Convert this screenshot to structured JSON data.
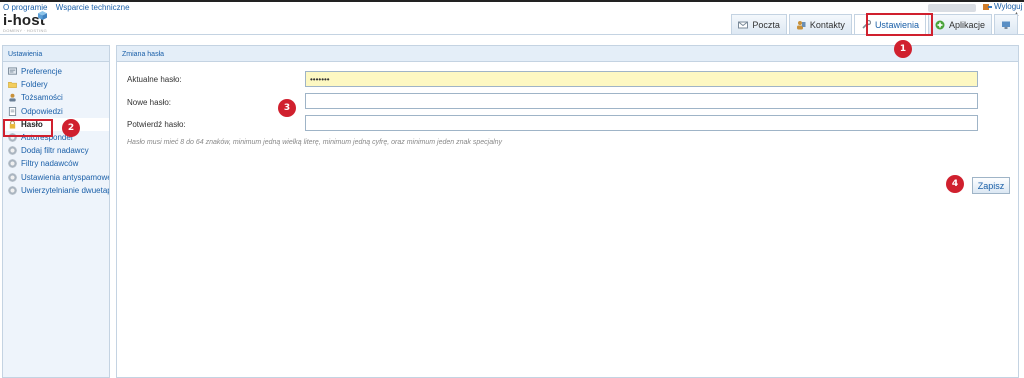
{
  "top_links": [
    "O programie",
    "Wsparcie techniczne"
  ],
  "logo_text": "i-host",
  "logo_sub": "DOMENY · HOSTING",
  "logout_label": "Wyloguj",
  "tabs": [
    {
      "label": "Poczta",
      "icon": "mail-icon"
    },
    {
      "label": "Kontakty",
      "icon": "contacts-icon"
    },
    {
      "label": "Ustawienia",
      "icon": "wrench-icon"
    },
    {
      "label": "Aplikacje",
      "icon": "plus-circle-icon"
    }
  ],
  "sidebar": {
    "title": "Ustawienia",
    "items": [
      {
        "label": "Preferencje",
        "icon": "preferences-icon"
      },
      {
        "label": "Foldery",
        "icon": "folder-icon"
      },
      {
        "label": "Tożsamości",
        "icon": "person-icon"
      },
      {
        "label": "Odpowiedzi",
        "icon": "document-icon"
      },
      {
        "label": "Hasło",
        "icon": "lock-icon"
      },
      {
        "label": "Autoresponder",
        "icon": "gear-icon"
      },
      {
        "label": "Dodaj filtr nadawcy",
        "icon": "gear-icon"
      },
      {
        "label": "Filtry nadawców",
        "icon": "gear-icon"
      },
      {
        "label": "Ustawienia antyspamowe",
        "icon": "gear-icon"
      },
      {
        "label": "Uwierzytelnianie dwuetapowe",
        "icon": "gear-icon"
      }
    ]
  },
  "panel": {
    "title": "Zmiana hasła",
    "current_label": "Aktualne hasło:",
    "current_value": "•••••••",
    "new_label": "Nowe hasło:",
    "confirm_label": "Potwierdź hasło:",
    "hint": "Hasło musi mieć 8 do 64 znaków, minimum jedną wielką literę, minimum jedną cyfrę, oraz minimum jeden znak specjalny",
    "save_label": "Zapisz"
  },
  "markers": [
    "1",
    "2",
    "3",
    "4"
  ],
  "colors": {
    "accent": "#1a5fa8",
    "highlight": "#d0202e",
    "field_filled": "#fdf8c2",
    "panel_bg": "#eef4fb"
  }
}
